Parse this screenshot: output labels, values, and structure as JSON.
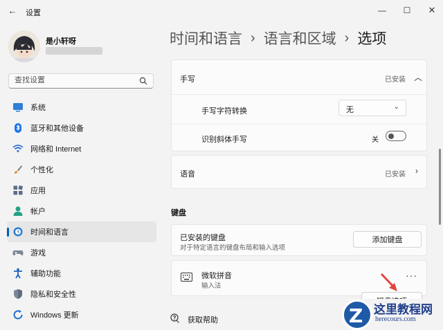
{
  "window": {
    "title": "设置",
    "back_icon": "back-arrow-icon",
    "controls": [
      "minimize-icon",
      "maximize-icon",
      "close-icon"
    ]
  },
  "user": {
    "name": "是小轩呀"
  },
  "search": {
    "placeholder": "查找设置",
    "icon": "search-icon"
  },
  "sidebar": {
    "items": [
      {
        "label": "系统",
        "icon": "system-icon",
        "active": false
      },
      {
        "label": "蓝牙和其他设备",
        "icon": "bluetooth-icon",
        "active": false
      },
      {
        "label": "网络和 Internet",
        "icon": "wifi-icon",
        "active": false
      },
      {
        "label": "个性化",
        "icon": "brush-icon",
        "active": false
      },
      {
        "label": "应用",
        "icon": "apps-icon",
        "active": false
      },
      {
        "label": "帐户",
        "icon": "account-icon",
        "active": false
      },
      {
        "label": "时间和语言",
        "icon": "globe-clock-icon",
        "active": true
      },
      {
        "label": "游戏",
        "icon": "gamepad-icon",
        "active": false
      },
      {
        "label": "辅助功能",
        "icon": "accessibility-icon",
        "active": false
      },
      {
        "label": "隐私和安全性",
        "icon": "shield-icon",
        "active": false
      },
      {
        "label": "Windows 更新",
        "icon": "update-icon",
        "active": false
      }
    ]
  },
  "breadcrumb": {
    "items": [
      "时间和语言",
      "语言和区域",
      "选项"
    ],
    "separator": "›"
  },
  "handwriting": {
    "title": "手写",
    "status": "已安装",
    "convert_label": "手写字符转换",
    "convert_value": "无",
    "italic_label": "识别斜体手写",
    "italic_state": "关",
    "italic_on": false
  },
  "speech": {
    "title": "语音",
    "status": "已安装"
  },
  "keyboard": {
    "section_title": "键盘",
    "installed_title": "已安装的键盘",
    "installed_desc": "对于特定语言的键盘布局和输入选项",
    "add_button": "添加键盘",
    "ime_name": "微软拼音",
    "ime_type": "输入法",
    "ime_icon": "keyboard-icon",
    "more": "···",
    "options_button": "键盘选项"
  },
  "help": {
    "label": "获取帮助",
    "icon": "help-icon"
  },
  "watermark": {
    "logo_letter": "Z",
    "text": "这里教程网",
    "url": "herecours.com"
  },
  "colors": {
    "accent": "#005fb8",
    "annotation_arrow": "#e0463f",
    "watermark": "#1f5aa6"
  }
}
